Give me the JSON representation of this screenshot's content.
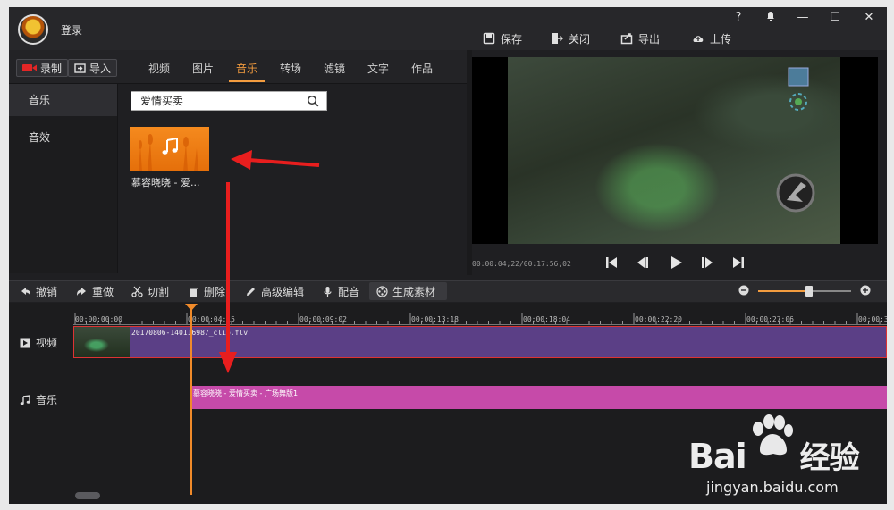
{
  "header": {
    "login": "登录",
    "window_buttons": [
      "?",
      "⌂",
      "—",
      "☐",
      "✕"
    ],
    "toolbar": {
      "save": "保存",
      "close": "关闭",
      "export": "导出",
      "upload": "上传"
    }
  },
  "left_panel": {
    "record": "录制",
    "import": "导入",
    "tabs": [
      "视频",
      "图片",
      "音乐",
      "转场",
      "滤镜",
      "文字",
      "作品"
    ],
    "active_tab": "音乐",
    "sidebar": [
      "音乐",
      "音效"
    ],
    "search_value": "爱情买卖",
    "thumb_label": "慕容晓晓 - 爱..."
  },
  "preview": {
    "timecode": "00:00:04;22/00:17:56;02"
  },
  "timeline_toolbar": {
    "undo": "撤销",
    "redo": "重做",
    "cut": "切割",
    "delete": "删除",
    "advanced_edit": "高级编辑",
    "dub": "配音",
    "generate": "生成素材",
    "zoom_level": 0.55
  },
  "timeline": {
    "ticks": [
      "00:00:00;00",
      "00:00:04;15",
      "00:00:09;02",
      "00:00:13;18",
      "00:00:18;04",
      "00:00:22;20",
      "00:00:27;06",
      "00:00:3"
    ],
    "video_label": "视频",
    "music_label": "音乐",
    "video_clip_name": "20170806-140116987_clip.flv",
    "music_clip_name": "慕容晓晓 - 爱情买卖 - 广场舞版1"
  },
  "watermark": {
    "brand": "Bai",
    "brand_suffix": "经验",
    "url": "jingyan.baidu.com"
  },
  "colors": {
    "accent": "#f39c3f",
    "video_track": "#5b3f86",
    "music_track": "#c64aa9"
  }
}
